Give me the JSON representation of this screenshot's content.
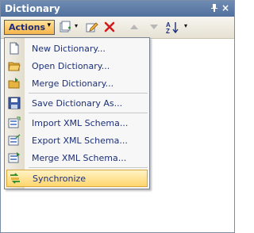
{
  "window": {
    "title": "Dictionary",
    "pin_glyph": "ᵖ",
    "close_glyph": "×"
  },
  "toolbar": {
    "actions_label": "Actions",
    "dropdown_glyph": "▾",
    "icons": [
      "add-item-icon",
      "edit-icon",
      "delete-icon",
      "move-up-icon",
      "move-down-icon",
      "sort-az-icon"
    ]
  },
  "menu": {
    "items": [
      {
        "label": "New Dictionary...",
        "icon": "new-document-icon"
      },
      {
        "label": "Open Dictionary...",
        "icon": "open-folder-icon"
      },
      {
        "label": "Merge Dictionary...",
        "icon": "merge-folder-icon"
      },
      {
        "label": "Save Dictionary As...",
        "icon": "save-disk-icon"
      },
      {
        "label": "Import XML Schema...",
        "icon": "import-xml-icon"
      },
      {
        "label": "Export XML Schema...",
        "icon": "export-xml-icon"
      },
      {
        "label": "Merge XML Schema...",
        "icon": "merge-xml-icon"
      },
      {
        "label": "Synchronize",
        "icon": "synchronize-icon"
      }
    ],
    "highlighted_index": 7
  },
  "colors": {
    "title_bar": "#5e7ca8",
    "menu_text": "#1c2f78",
    "highlight": "#ffd66e"
  }
}
